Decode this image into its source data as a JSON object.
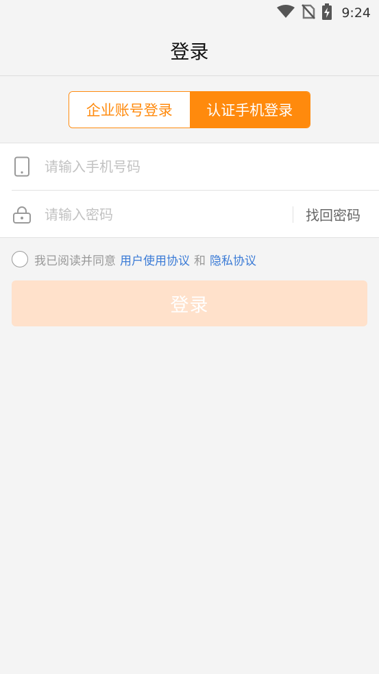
{
  "status_bar": {
    "time": "9:24",
    "icons": [
      "wifi-icon",
      "no-sim-icon",
      "battery-charging-icon"
    ]
  },
  "header": {
    "title": "登录"
  },
  "tabs": {
    "enterprise_label": "企业账号登录",
    "phone_label": "认证手机登录",
    "active": "phone"
  },
  "form": {
    "phone_placeholder": "请输入手机号码",
    "phone_value": "",
    "password_placeholder": "请输入密码",
    "password_value": "",
    "find_password": "找回密码"
  },
  "agreement": {
    "prefix": "我已阅读并同意",
    "user_agreement": "用户使用协议",
    "and": "和",
    "privacy_policy": "隐私协议",
    "checked": false
  },
  "login_button": {
    "label": "登录"
  },
  "colors": {
    "accent": "#ff8a0d",
    "link": "#3b7bd6",
    "disabled_button": "#ffe1cb"
  }
}
